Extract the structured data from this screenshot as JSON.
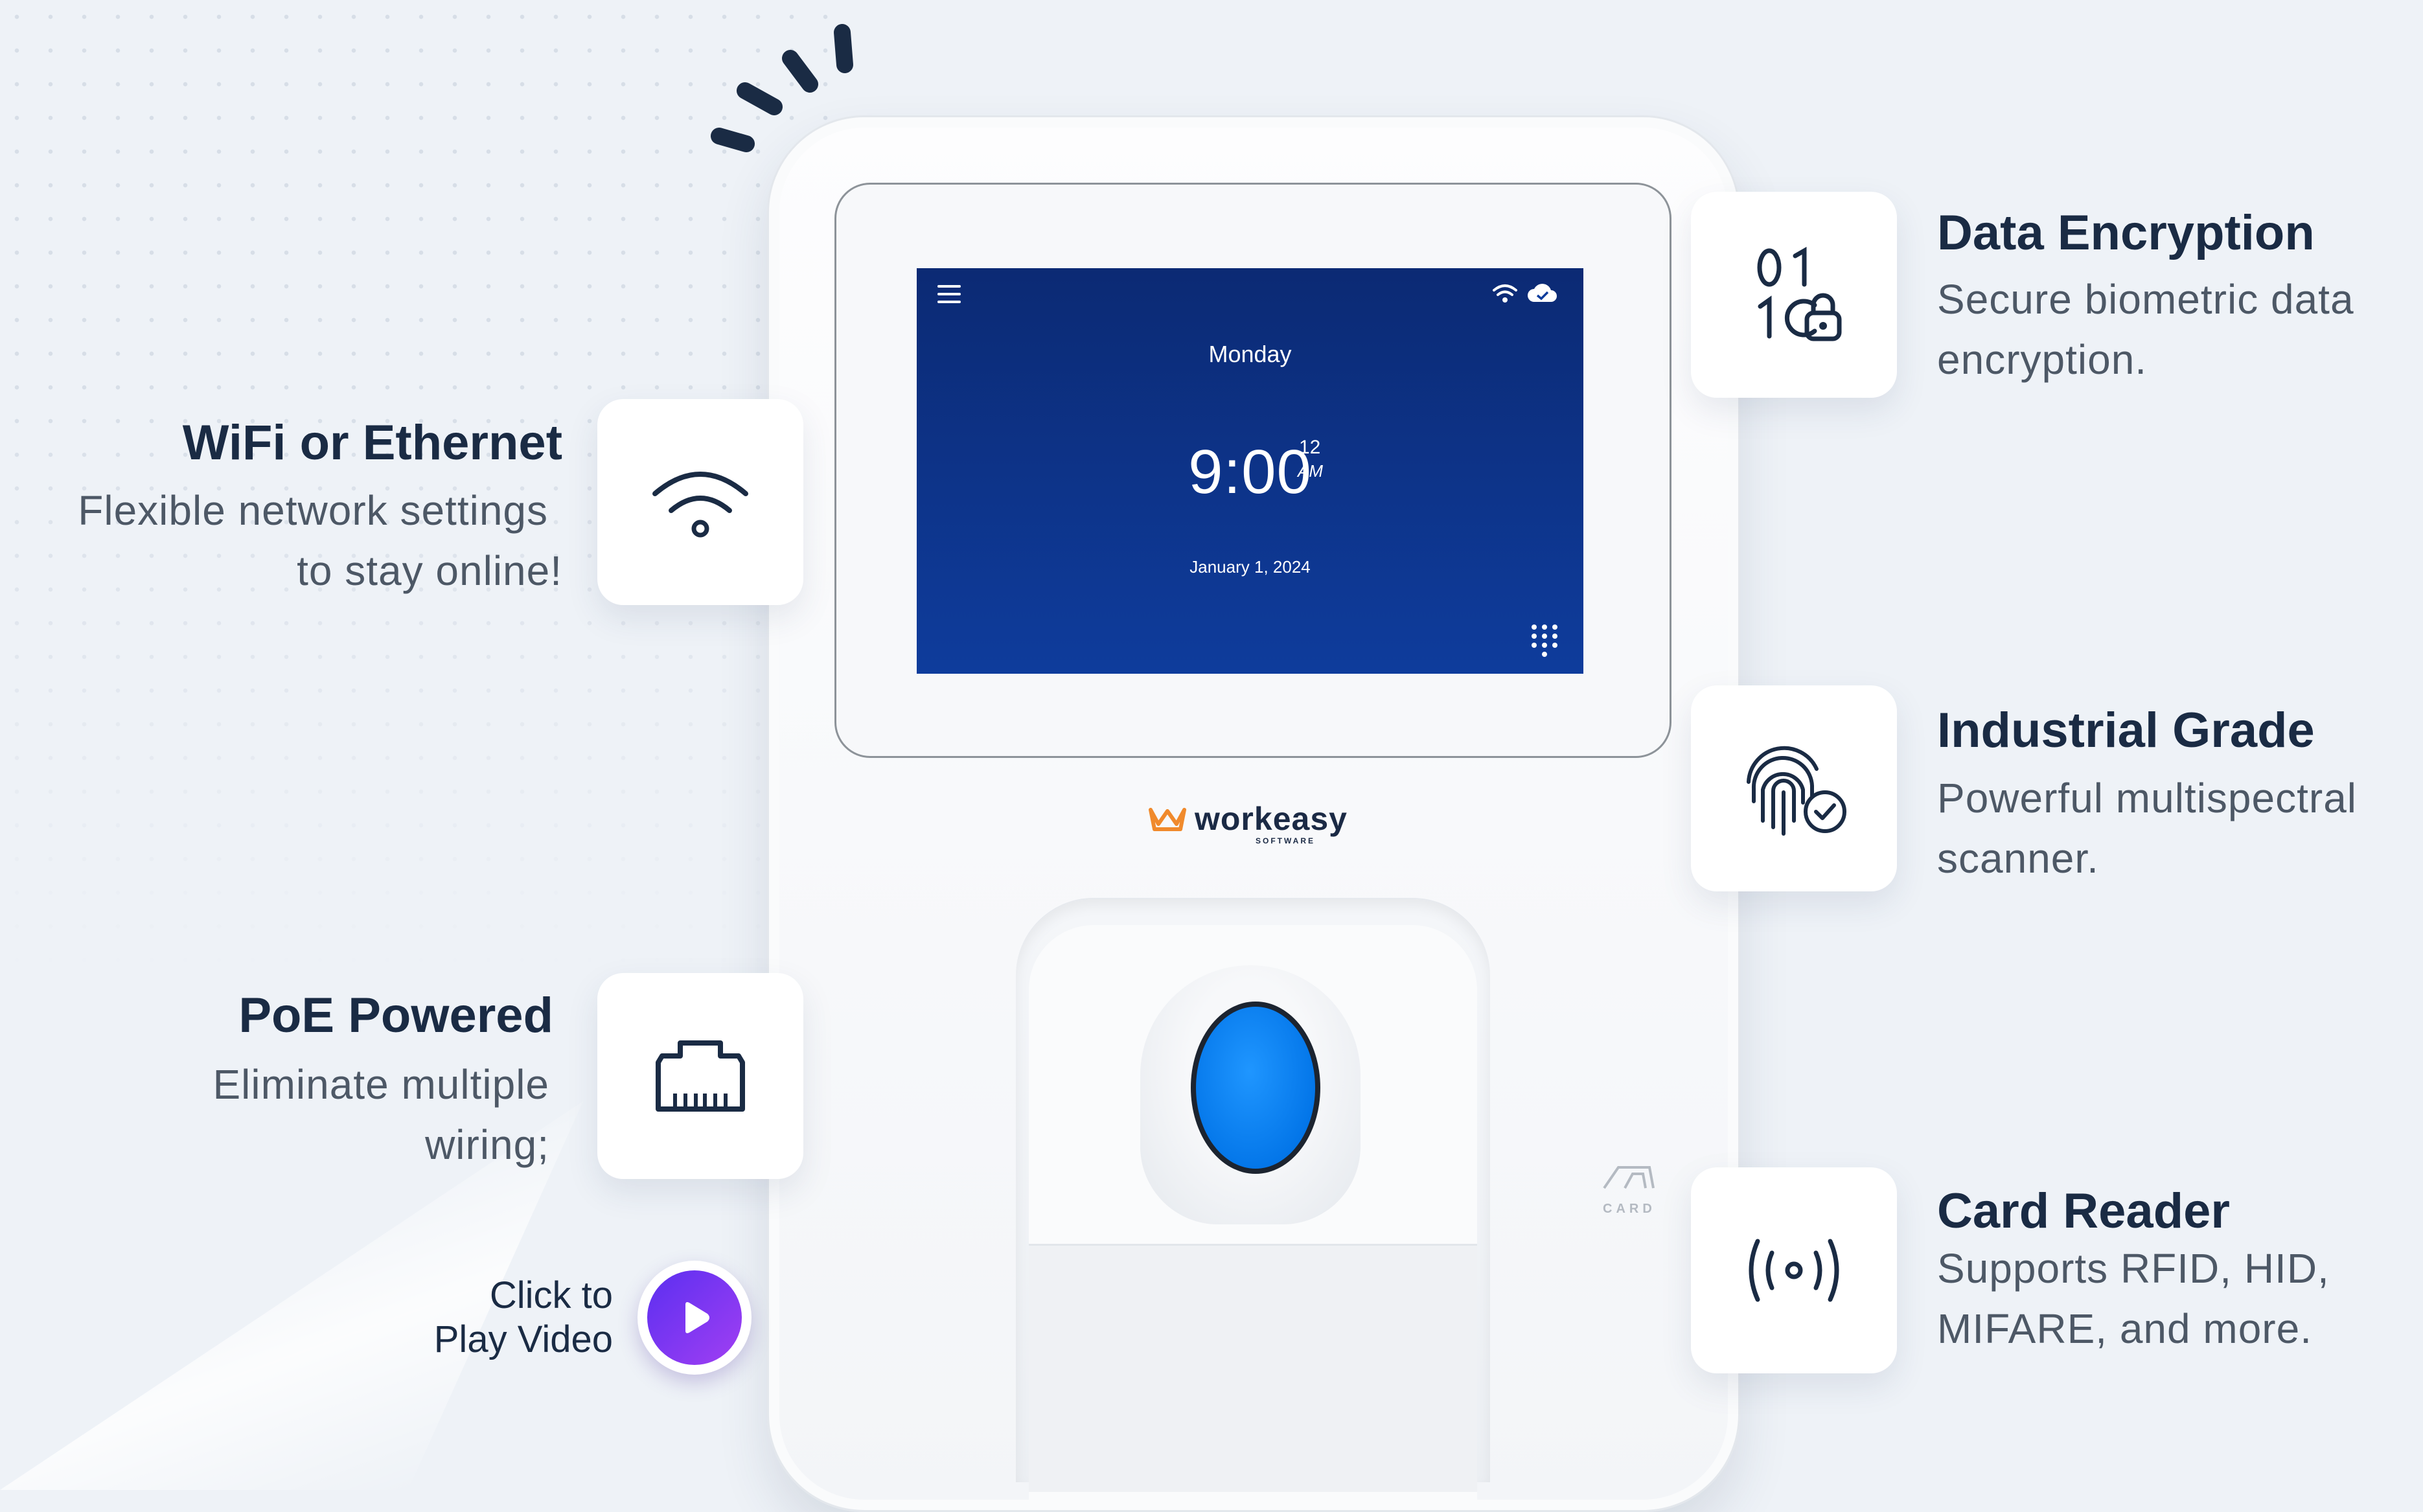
{
  "device": {
    "screen": {
      "day": "Monday",
      "time_hm": "9:00",
      "time_sec": "12",
      "time_ampm": "AM",
      "date": "January 1, 2024",
      "icons": [
        "menu-icon",
        "wifi-icon",
        "cloud-check-icon",
        "keypad-icon"
      ]
    },
    "brand": {
      "name": "workeasy",
      "sub": "SOFTWARE"
    },
    "card_label": "CARD"
  },
  "features": {
    "wifi": {
      "title": "WiFi or Ethernet",
      "desc_line1": "Flexible network settings",
      "desc_line2": "to stay online!",
      "icon": "wifi-icon"
    },
    "poe": {
      "title": "PoE Powered",
      "desc_line1": "Eliminate multiple",
      "desc_line2": "wiring;",
      "icon": "ethernet-port-icon"
    },
    "encryption": {
      "title": "Data Encryption",
      "desc_line1": "Secure biometric data",
      "desc_line2": "encryption.",
      "icon": "binary-lock-icon"
    },
    "industrial": {
      "title": "Industrial Grade",
      "desc_line1": "Powerful multispectral",
      "desc_line2": "scanner.",
      "icon": "fingerprint-check-icon"
    },
    "card_reader": {
      "title": "Card Reader",
      "desc_line1": "Supports RFID, HID,",
      "desc_line2": "MIFARE, and more.",
      "icon": "rfid-signal-icon"
    }
  },
  "video": {
    "line1": "Click to",
    "line2": "Play Video",
    "icon": "play-icon"
  },
  "colors": {
    "screen": "#0e3c9c",
    "fingerpad": "#0a84ff",
    "play_button": "#7a35f2",
    "title": "#1a2b44",
    "text": "#4d5866"
  }
}
